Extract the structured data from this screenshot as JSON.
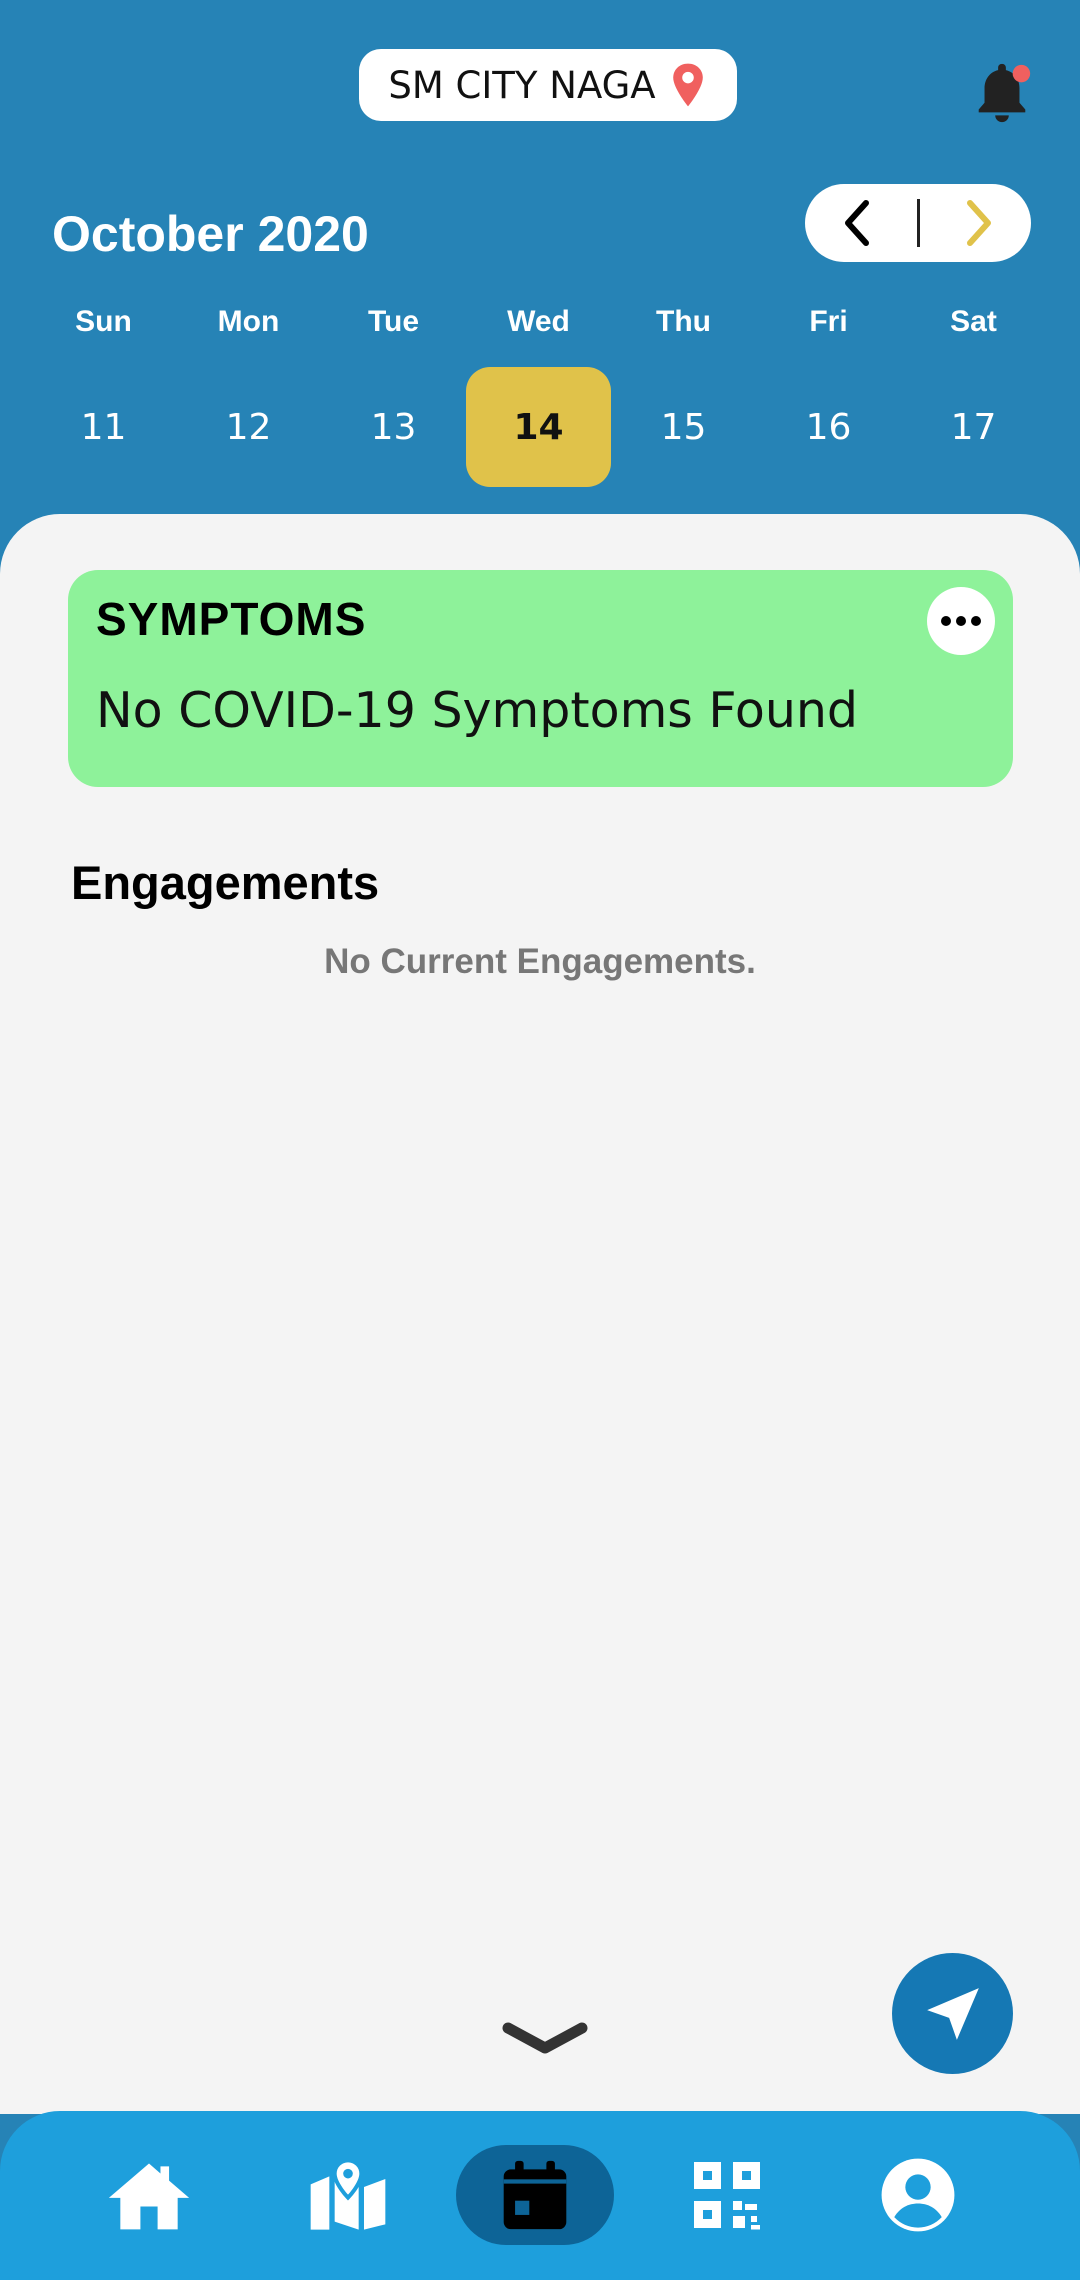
{
  "header": {
    "location": "SM CITY NAGA",
    "location_icon": "map-pin-icon",
    "notification_icon": "bell-icon",
    "colors": {
      "background": "#2683b6",
      "pin": "#f0605f",
      "badge": "#f0605f"
    }
  },
  "calendar": {
    "month_title": "October 2020",
    "prev_icon": "chevron-left-icon",
    "next_icon": "chevron-right-icon",
    "weekdays": [
      "Sun",
      "Mon",
      "Tue",
      "Wed",
      "Thu",
      "Fri",
      "Sat"
    ],
    "days": [
      "11",
      "12",
      "13",
      "14",
      "15",
      "16",
      "17"
    ],
    "selected_day": "14",
    "selected_color": "#e0c24a"
  },
  "symptoms": {
    "title": "SYMPTOMS",
    "status": "No COVID-19 Symptoms Found",
    "more_icon": "more-horizontal-icon",
    "card_color": "#8ef29a"
  },
  "engagements": {
    "title": "Engagements",
    "empty_text": "No Current Engagements."
  },
  "bottom_nav": {
    "items": [
      {
        "icon": "home-icon",
        "active": false
      },
      {
        "icon": "map-icon",
        "active": false
      },
      {
        "icon": "calendar-icon",
        "active": true
      },
      {
        "icon": "qr-code-icon",
        "active": false
      },
      {
        "icon": "user-icon",
        "active": false
      }
    ],
    "color": "#1e9fdc",
    "active_color": "#0d6497"
  },
  "fab_icon": "navigation-arrow-icon",
  "collapse_icon": "chevron-down-icon"
}
